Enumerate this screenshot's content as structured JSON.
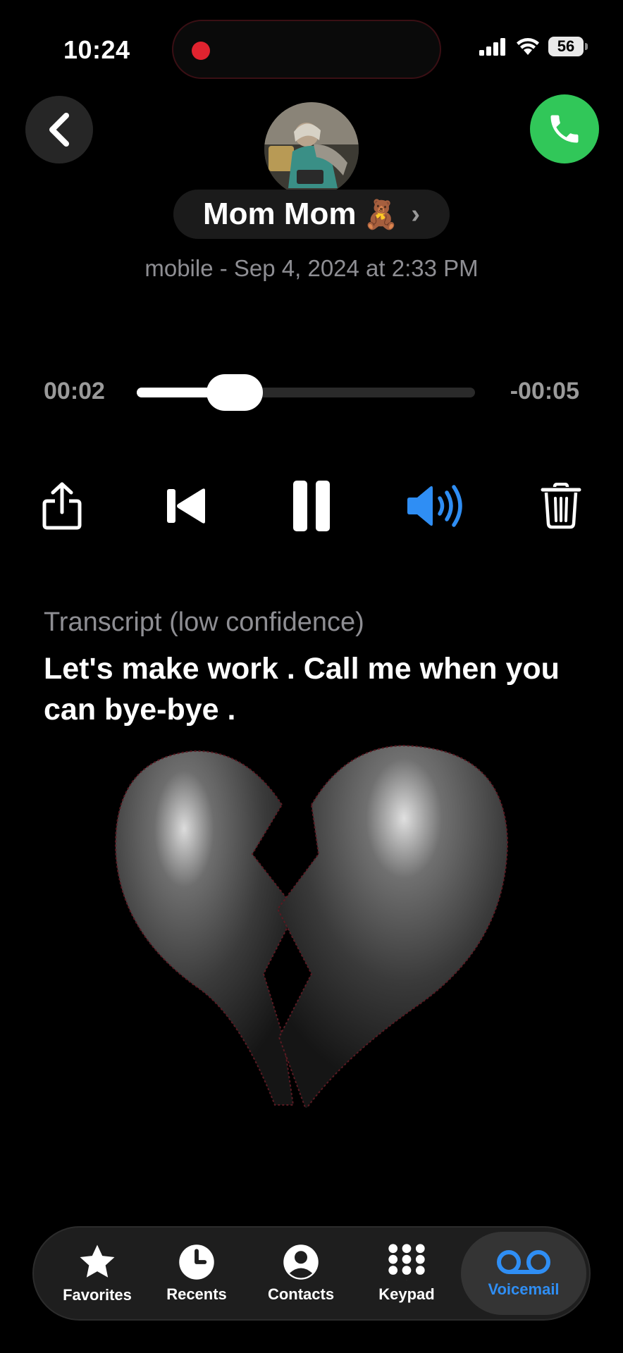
{
  "status_bar": {
    "time": "10:24",
    "battery": "56",
    "icons": [
      "cellular-signal-icon",
      "wifi-icon",
      "battery-icon"
    ]
  },
  "header": {
    "back_icon": "chevron-left-icon",
    "call_icon": "phone-icon",
    "contact_name": "Mom Mom",
    "contact_emoji": "🧸",
    "chevron": "›",
    "meta": "mobile - Sep 4, 2024 at 2:33 PM"
  },
  "player": {
    "elapsed": "00:02",
    "remaining": "-00:05",
    "progress": 0.29,
    "controls": [
      "share-icon",
      "rewind-icon",
      "pause-icon",
      "speaker-icon",
      "trash-icon"
    ]
  },
  "transcript": {
    "label": "Transcript (low confidence)",
    "text": "Let's make work . Call me when you can bye-bye ."
  },
  "tabbar": {
    "tabs": [
      {
        "label": "Favorites",
        "icon": "star-icon"
      },
      {
        "label": "Recents",
        "icon": "clock-icon"
      },
      {
        "label": "Contacts",
        "icon": "person-icon"
      },
      {
        "label": "Keypad",
        "icon": "keypad-icon"
      },
      {
        "label": "Voicemail",
        "icon": "voicemail-icon",
        "active": true
      }
    ]
  },
  "colors": {
    "accent": "#2f8ef4",
    "call_green": "#31c759",
    "secondary_text": "#8e8e93"
  }
}
